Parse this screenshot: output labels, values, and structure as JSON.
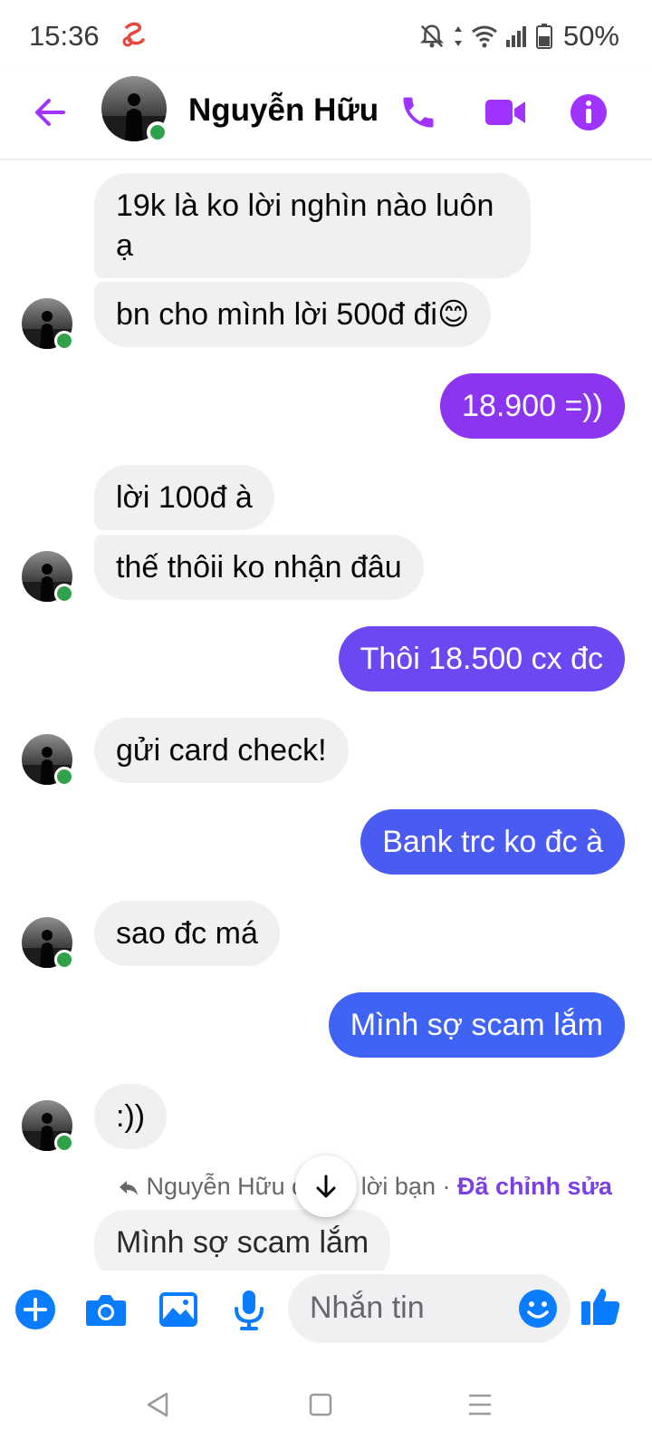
{
  "status_bar": {
    "time": "15:36",
    "battery": "50%"
  },
  "header": {
    "name": "Nguyễn Hữu"
  },
  "messages": [
    {
      "side": "in",
      "text": "19k là ko lời nghìn nào luôn",
      "text2": "ạ"
    },
    {
      "side": "in",
      "text": "bn cho mình lời 500đ đi😊"
    },
    {
      "side": "out",
      "text": "18.900 =))"
    },
    {
      "side": "in",
      "text": "lời 100đ à"
    },
    {
      "side": "in",
      "text": "thế thôii ko nhận đâu"
    },
    {
      "side": "out",
      "text": "Thôi 18.500 cx đc"
    },
    {
      "side": "in",
      "text": "gửi card check!"
    },
    {
      "side": "out",
      "text": "Bank trc ko đc à"
    },
    {
      "side": "in",
      "text": "sao đc má"
    },
    {
      "side": "out",
      "text": "Mình sợ scam lắm"
    },
    {
      "side": "in",
      "text": ":))"
    }
  ],
  "reply_info": {
    "prefix": "Nguyễn Hữu đã trả lời bạn · ",
    "edited": "Đã chỉnh sửa"
  },
  "quoted_preview": "Mình sợ scam lắm",
  "composer": {
    "placeholder": "Nhắn tin"
  },
  "colors": {
    "accent": "#a033ff",
    "out_purple": "#8b35f0",
    "out_blue": "#4a5bf2",
    "online": "#31a24c",
    "icon_blue": "#0a7cff"
  },
  "icons": {
    "back": "arrow-left-icon",
    "call": "phone-icon",
    "video": "video-camera-icon",
    "info": "info-icon",
    "add": "plus-circle-icon",
    "camera": "camera-icon",
    "gallery": "image-icon",
    "mic": "microphone-icon",
    "emoji": "smiley-icon",
    "like": "thumbs-up-icon",
    "scroll": "arrow-down-icon"
  }
}
